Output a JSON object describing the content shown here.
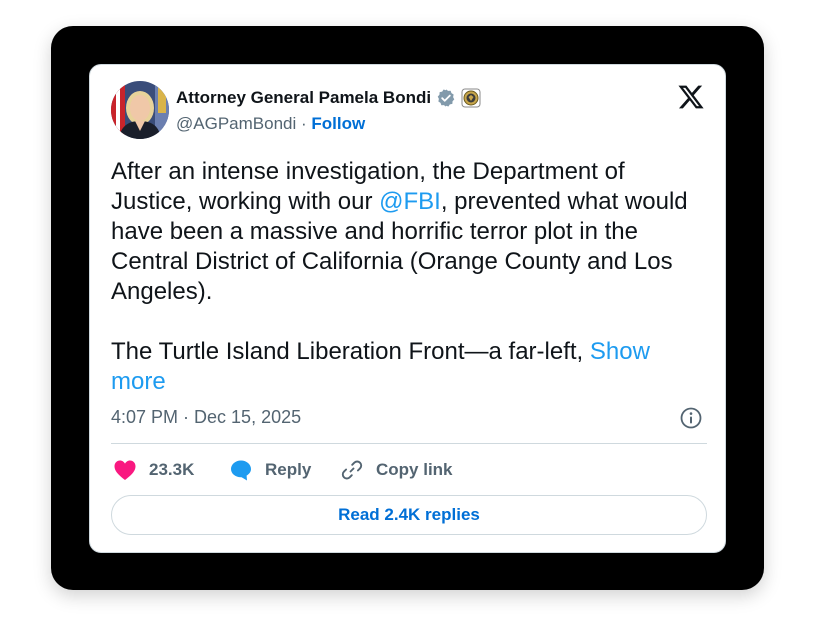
{
  "tweet": {
    "author_name": "Attorney General Pamela Bondi",
    "handle": "@AGPamBondi",
    "separator": "·",
    "follow_label": "Follow",
    "body_part1": "After an intense investigation, the Department of Justice, working with our ",
    "mention": "@FBI",
    "body_part2": ", prevented what would have been a massive and horrific terror plot in the Central District of California (Orange County and Los Angeles).",
    "body_para2": "The Turtle Island Liberation Front—a far-left, ",
    "show_more": "Show more",
    "timestamp": "4:07 PM · Dec 15, 2025"
  },
  "actions": {
    "likes": "23.3K",
    "reply_label": "Reply",
    "copy_link_label": "Copy link",
    "read_replies_label": "Read 2.4K replies"
  },
  "icons": {
    "verified": "verified-badge-icon",
    "affiliation": "doj-seal-icon",
    "brand": "x-logo-icon",
    "info": "info-icon",
    "like": "heart-icon",
    "reply": "reply-bubble-icon",
    "copy": "link-icon"
  },
  "colors": {
    "like": "#f91880",
    "reply": "#1d9bf0",
    "link": "#1d9bf0",
    "follow": "#006fd6",
    "verified": "#829aab"
  }
}
